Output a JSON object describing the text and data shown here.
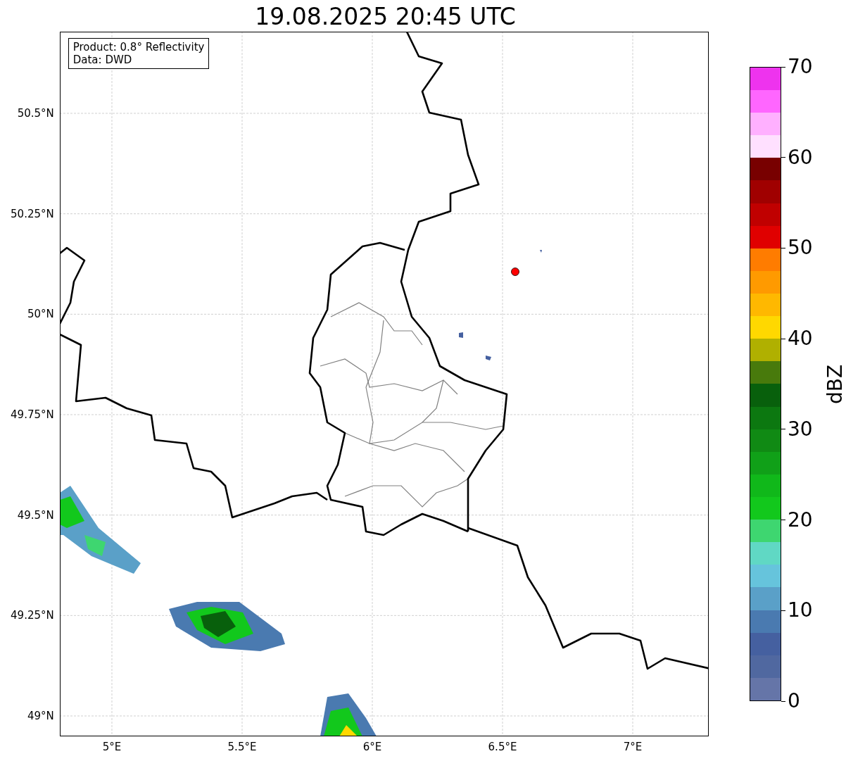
{
  "title": "19.08.2025 20:45 UTC",
  "legend": [
    "Product: 0.8° Reflectivity",
    "Data: DWD"
  ],
  "lat_ticks": [
    "50.5°N",
    "50.25°N",
    "50°N",
    "49.75°N",
    "49.5°N",
    "49.25°N",
    "49°N"
  ],
  "lon_ticks": [
    "5°E",
    "5.5°E",
    "6°E",
    "6.5°E",
    "7°E"
  ],
  "colorbar": {
    "label": "dBZ",
    "ticks": [
      "70",
      "60",
      "50",
      "40",
      "30",
      "20",
      "10",
      "0"
    ],
    "bands": [
      {
        "color": "#6575a8"
      },
      {
        "color": "#5068a0"
      },
      {
        "color": "#4560a0"
      },
      {
        "color": "#4a7ab0"
      },
      {
        "color": "#5aa0c8"
      },
      {
        "color": "#66c4dc"
      },
      {
        "color": "#60d8c4"
      },
      {
        "color": "#3ed670"
      },
      {
        "color": "#12c81c"
      },
      {
        "color": "#10b81a"
      },
      {
        "color": "#10a018"
      },
      {
        "color": "#108a14"
      },
      {
        "color": "#0c7810"
      },
      {
        "color": "#08600c"
      },
      {
        "color": "#487a0c"
      },
      {
        "color": "#b0b000"
      },
      {
        "color": "#ffd800"
      },
      {
        "color": "#ffb800"
      },
      {
        "color": "#ff9a00"
      },
      {
        "color": "#ff7c00"
      },
      {
        "color": "#e00000"
      },
      {
        "color": "#c00000"
      },
      {
        "color": "#a00000"
      },
      {
        "color": "#780000"
      },
      {
        "color": "#ffe0ff"
      },
      {
        "color": "#ffb0ff"
      },
      {
        "color": "#ff66ff"
      },
      {
        "color": "#ee33ee"
      }
    ]
  }
}
